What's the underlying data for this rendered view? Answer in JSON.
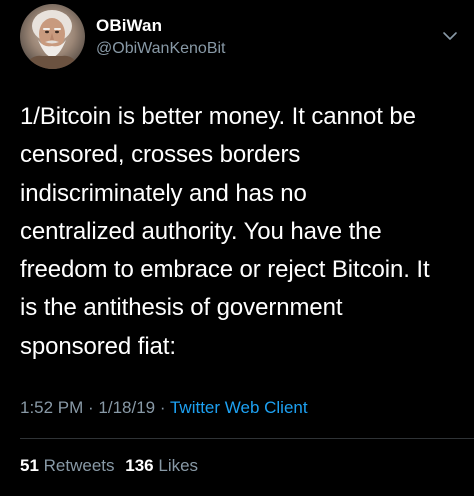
{
  "tweet": {
    "author": {
      "display_name": "OBiWan",
      "handle": "@ObiWanKenoBit",
      "avatar_icon": "profile-photo"
    },
    "menu_icon": "chevron-down-icon",
    "text": "1/Bitcoin is better money. It cannot be\ncensored, crosses borders\nindiscriminately and has no\ncentralized authority. You have the\nfreedom to embrace or reject Bitcoin. It\nis the antithesis of government\nsponsored fiat:",
    "time": "1:52 PM",
    "separator1": " · ",
    "date": "1/18/19",
    "separator2": " · ",
    "source": "Twitter Web Client",
    "stats": {
      "retweets_count": "51",
      "retweets_label": "Retweets",
      "likes_count": "136",
      "likes_label": "Likes"
    }
  },
  "colors": {
    "background": "#000000",
    "text": "#ffffff",
    "secondary": "#8899a6",
    "link": "#1da1f2",
    "divider": "#2f3336"
  }
}
